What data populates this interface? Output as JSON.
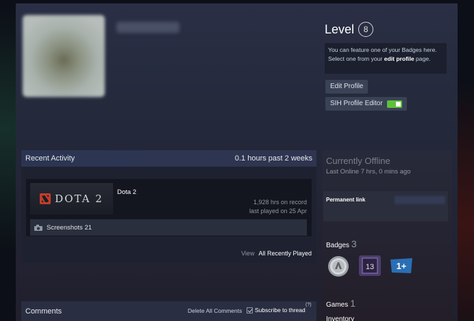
{
  "header": {
    "level_label": "Level",
    "level_value": "8",
    "badge_hint_text": "You can feature one of your Badges here. Select one from your ",
    "badge_hint_link": "edit profile",
    "badge_hint_end": " page.",
    "edit_profile": "Edit Profile",
    "sih_editor": "SIH Profile Editor",
    "sih_toggle_on": true
  },
  "recent_activity": {
    "title": "Recent Activity",
    "hours_summary": "0.1 hours past 2 weeks",
    "game": {
      "logo_text": "DOTA 2",
      "name": "Dota 2",
      "hours_on_record": "1,928 hrs on record",
      "last_played": "last played on 25 Apr",
      "screenshots": "Screenshots 21"
    },
    "view_label": "View",
    "view_link": "All Recently Played"
  },
  "comments": {
    "title": "Comments",
    "delete_all": "Delete All Comments",
    "subscribe": "Subscribe to thread",
    "help": "(?)"
  },
  "sidebar": {
    "status_title": "Currently Offline",
    "status_sub": "Last Online 7 hrs, 0 mins ago",
    "permalink_label": "Permanent link",
    "badges_label": "Badges",
    "badges_count": "3",
    "badge_items": [
      "coin-badge-icon",
      "badge-13-icon",
      "badge-1plus-icon"
    ],
    "badge_13_text": "13",
    "badge_1plus_text": "1+",
    "games_label": "Games",
    "games_count": "1",
    "inventory_label": "Inventory"
  },
  "colors": {
    "accent_green": "#5fc13b",
    "dota_red": "#c23c2a",
    "badge_purple": "#4c3d6e",
    "badge_blue": "#2a6fb4"
  }
}
